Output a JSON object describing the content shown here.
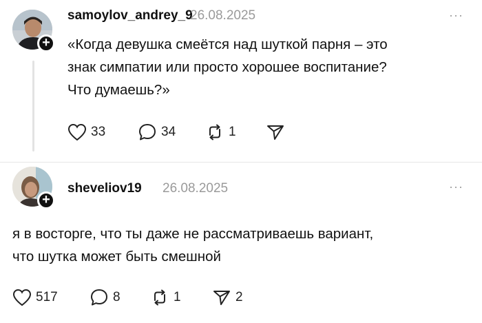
{
  "posts": [
    {
      "username": "samoylov_andrey_9",
      "date": "26.08.2025",
      "text_lines": [
        "«Когда девушка смеётся над шуткой парня – это",
        "знак симпатии или просто хорошее воспитание?",
        "Что думаешь?»"
      ],
      "likes": "33",
      "comments": "34",
      "reposts": "1",
      "shares": ""
    },
    {
      "username": "sheveliov19",
      "date": "26.08.2025",
      "text_lines": [
        "я в восторге, что ты даже не рассматриваешь вариант,",
        "что шутка может быть смешной"
      ],
      "likes": "517",
      "comments": "8",
      "reposts": "1",
      "shares": "2"
    }
  ],
  "more_label": "···",
  "plus_label": "+",
  "icons": {
    "like": "heart-icon",
    "comment": "comment-bubble-icon",
    "repost": "repost-icon",
    "share": "send-icon",
    "more": "more-dots-icon",
    "follow": "follow-plus-icon"
  }
}
